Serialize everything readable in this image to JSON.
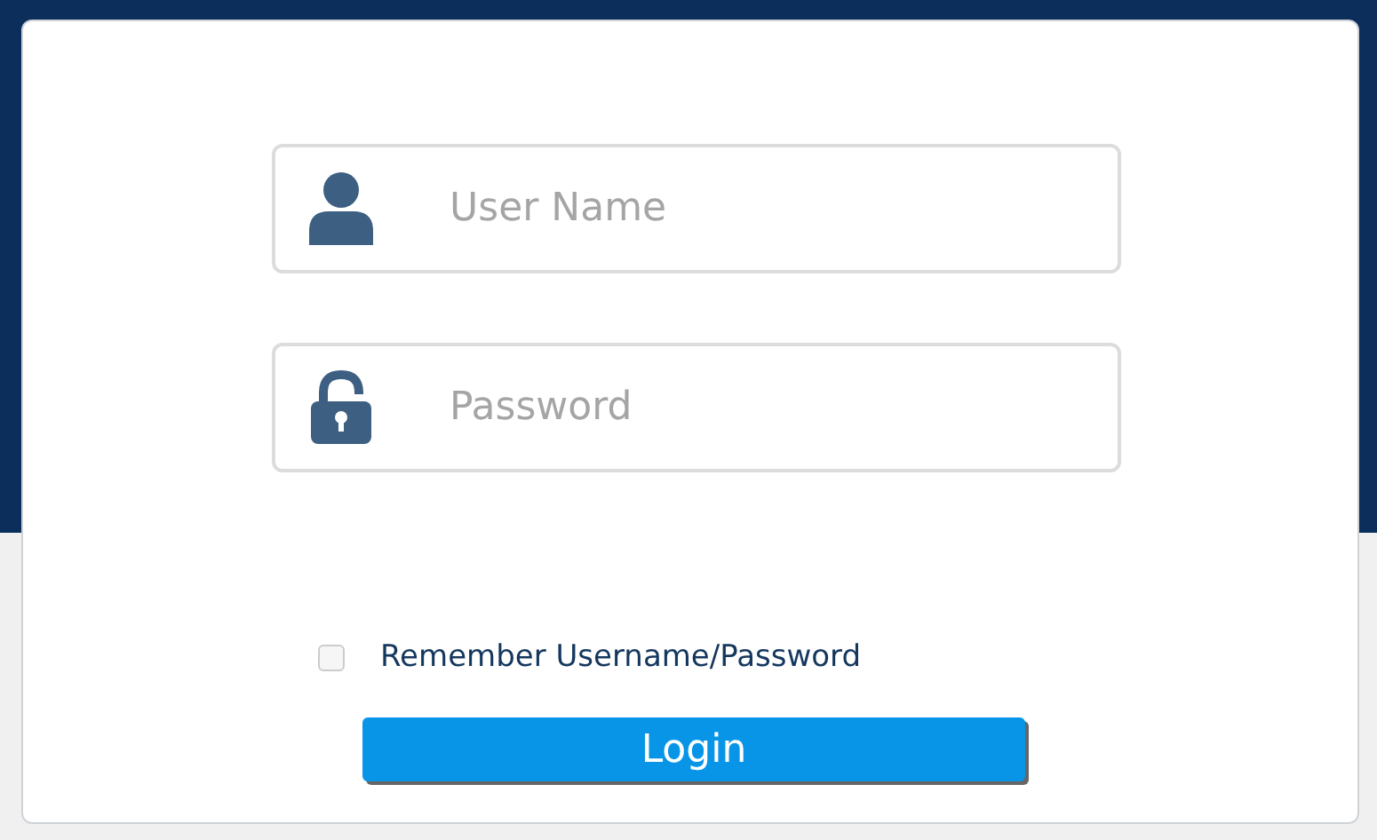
{
  "fields": [
    {
      "kind": "user",
      "placeholder": "User Name"
    },
    {
      "kind": "password",
      "placeholder": "Password"
    }
  ],
  "remember": {
    "label": "Remember Username/Password",
    "checked": false
  },
  "login_button": {
    "label": "Login"
  }
}
